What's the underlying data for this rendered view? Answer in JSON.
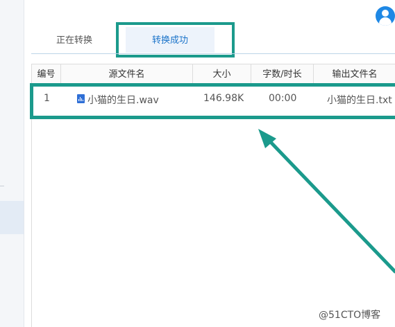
{
  "tabs": [
    {
      "label": "正在转换",
      "active": false
    },
    {
      "label": "转换成功",
      "active": true
    }
  ],
  "table": {
    "headers": [
      "编号",
      "源文件名",
      "大小",
      "字数/时长",
      "输出文件名"
    ],
    "rows": [
      {
        "index": "1",
        "source_file": "小猫的生日.wav",
        "size": "146.98K",
        "duration": "00:00",
        "output_file": "小猫的生日.txt"
      }
    ]
  },
  "watermark": "@51CTO博客",
  "icons": {
    "avatar": "user-avatar-icon",
    "file": "audio-file-icon"
  },
  "colors": {
    "accent": "#1a73c9",
    "highlight": "#1b9a8c",
    "avatar": "#1e88e5"
  }
}
